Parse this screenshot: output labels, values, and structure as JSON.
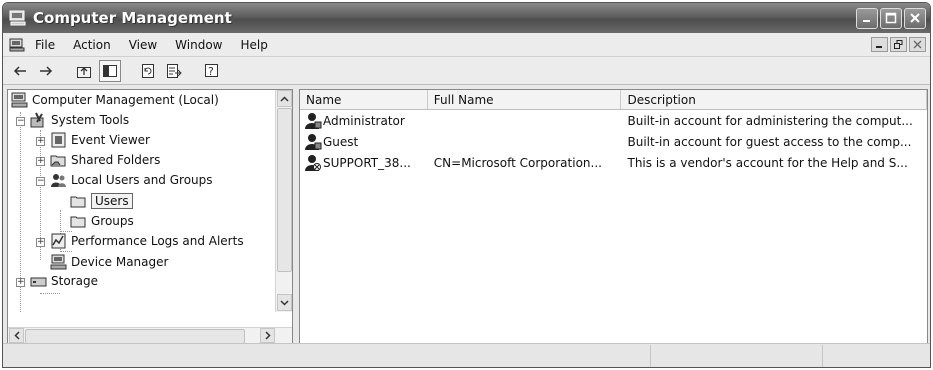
{
  "window": {
    "title": "Computer Management"
  },
  "menubar": {
    "items": [
      {
        "label": "File"
      },
      {
        "label": "Action"
      },
      {
        "label": "View"
      },
      {
        "label": "Window"
      },
      {
        "label": "Help"
      }
    ]
  },
  "toolbar": {
    "icons": [
      "back-arrow-icon",
      "forward-arrow-icon",
      "up-one-level-icon",
      "show-hide-console-tree-icon",
      "refresh-icon",
      "export-list-icon",
      "help-icon"
    ]
  },
  "tree": {
    "items": [
      {
        "label": "Computer Management (Local)",
        "icon": "computer-management-icon"
      },
      {
        "label": "System Tools",
        "icon": "system-tools-icon"
      },
      {
        "label": "Event Viewer",
        "icon": "event-viewer-icon"
      },
      {
        "label": "Shared Folders",
        "icon": "shared-folders-icon"
      },
      {
        "label": "Local Users and Groups",
        "icon": "users-groups-icon"
      },
      {
        "label": "Users",
        "icon": "folder-icon",
        "selected": true
      },
      {
        "label": "Groups",
        "icon": "folder-icon"
      },
      {
        "label": "Performance Logs and Alerts",
        "icon": "performance-logs-icon"
      },
      {
        "label": "Device Manager",
        "icon": "device-manager-icon"
      },
      {
        "label": "Storage",
        "icon": "storage-icon"
      }
    ]
  },
  "list": {
    "columns": [
      "Name",
      "Full Name",
      "Description"
    ],
    "rows": [
      {
        "name": "Administrator",
        "full_name": "",
        "description": "Built-in account for administering the comput..."
      },
      {
        "name": "Guest",
        "full_name": "",
        "description": "Built-in account for guest access to the comp..."
      },
      {
        "name": "SUPPORT_38...",
        "full_name": "CN=Microsoft Corporation...",
        "description": "This is a vendor's account for the Help and S..."
      }
    ]
  },
  "colors": {
    "titlebar": "#5e5e5e",
    "selection_border": "#666666"
  }
}
